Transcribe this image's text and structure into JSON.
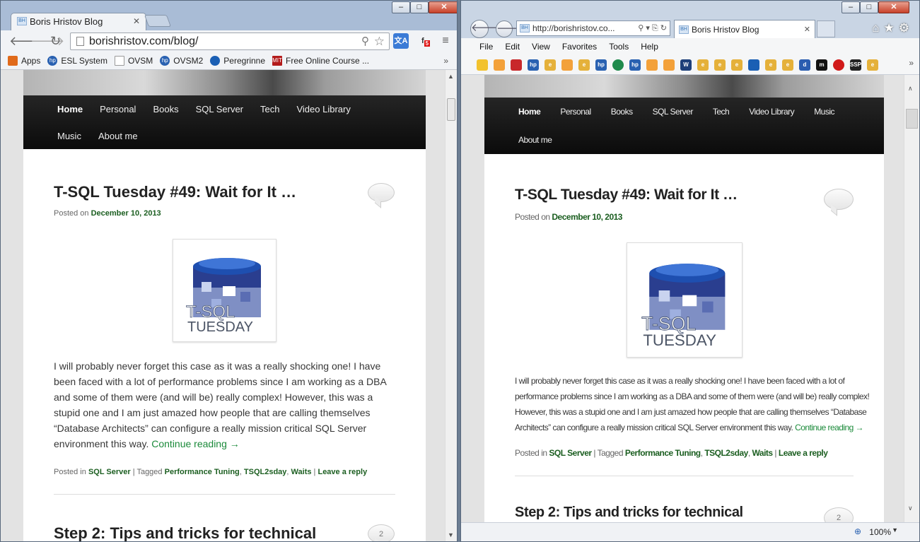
{
  "chrome": {
    "tab_title": "Boris Hristov Blog",
    "favicon_text": "BH",
    "url": "borishristov.com/blog/",
    "bookmarks": [
      {
        "label": "Apps",
        "color": "#e06a1b"
      },
      {
        "label": "ESL System",
        "color": "#2961b1"
      },
      {
        "label": "OVSM",
        "color": "#888888"
      },
      {
        "label": "OVSM2",
        "color": "#2961b1"
      },
      {
        "label": "Peregrinne",
        "color": "#1a5fb4"
      },
      {
        "label": "Free Online Course ...",
        "color": "#b31b1b"
      }
    ],
    "bookmark_overflow": "»",
    "extension_badge": "5"
  },
  "ie": {
    "url": "http://borishristov.co...",
    "tab_title": "Boris Hristov Blog",
    "favicon_text": "BH",
    "menu": [
      "File",
      "Edit",
      "View",
      "Favorites",
      "Tools",
      "Help"
    ],
    "fav_overflow": "»",
    "zoom": "100%",
    "fav_icons": [
      {
        "name": "star-icon",
        "color": "#f2c22e",
        "text": ""
      },
      {
        "name": "feed-icon",
        "color": "#f3a13a",
        "text": ""
      },
      {
        "name": "diamond-icon",
        "color": "#c8282b",
        "text": ""
      },
      {
        "name": "hp-icon",
        "color": "#2961b1",
        "text": "hp"
      },
      {
        "name": "ie-page-icon",
        "color": "#e5b13a",
        "text": "e"
      },
      {
        "name": "feed-icon",
        "color": "#f3a13a",
        "text": ""
      },
      {
        "name": "ie-page-icon",
        "color": "#e5b13a",
        "text": "e"
      },
      {
        "name": "hp-icon",
        "color": "#2961b1",
        "text": "hp"
      },
      {
        "name": "globe-icon",
        "color": "#1f8a4c",
        "text": ""
      },
      {
        "name": "hp-icon",
        "color": "#2961b1",
        "text": "hp"
      },
      {
        "name": "feed-icon",
        "color": "#f3a13a",
        "text": ""
      },
      {
        "name": "feed-icon",
        "color": "#f3a13a",
        "text": ""
      },
      {
        "name": "w-icon",
        "color": "#1d3f7a",
        "text": "W"
      },
      {
        "name": "ie-page-icon",
        "color": "#e5b13a",
        "text": "e"
      },
      {
        "name": "ie-page-icon",
        "color": "#e5b13a",
        "text": "e"
      },
      {
        "name": "ie-page-icon",
        "color": "#e5b13a",
        "text": "e"
      },
      {
        "name": "peregrine-icon",
        "color": "#1a5fb4",
        "text": ""
      },
      {
        "name": "ie-page-icon",
        "color": "#e5b13a",
        "text": "e"
      },
      {
        "name": "ie-page-icon",
        "color": "#e5b13a",
        "text": "e"
      },
      {
        "name": "d-icon",
        "color": "#2a5db0",
        "text": "d"
      },
      {
        "name": "m-icon",
        "color": "#111111",
        "text": "m"
      },
      {
        "name": "red-dot-icon",
        "color": "#d11a1a",
        "text": ""
      },
      {
        "name": "ssp-icon",
        "color": "#222222",
        "text": "SSP"
      },
      {
        "name": "ie-page-icon",
        "color": "#e5b13a",
        "text": "e"
      }
    ]
  },
  "blog": {
    "nav_chrome_row1": [
      "Home",
      "Personal",
      "Books",
      "SQL Server",
      "Tech",
      "Video Library"
    ],
    "nav_chrome_row2": [
      "Music",
      "About me"
    ],
    "nav_ie_row1": [
      "Home",
      "Personal",
      "Books",
      "SQL Server",
      "Tech",
      "Video Library",
      "Music"
    ],
    "nav_ie_row2": [
      "About me"
    ],
    "post1": {
      "title": "T-SQL Tuesday #49: Wait for It …",
      "posted_on": "Posted on",
      "date": "December 10, 2013",
      "logo_line1": "T-SQL",
      "logo_line2": "TUESDAY",
      "excerpt_chrome": [
        "I will probably never forget this case as it was a really shocking one! I have",
        "been faced with a lot of performance problems since I am working as a DBA",
        "and some of them were (and will be) really complex! However, this was a",
        "stupid one and I am just amazed how people that are calling themselves",
        "“Database Architects” can configure a really mission critical SQL Server",
        "environment this way."
      ],
      "excerpt_ie": [
        "I will probably never forget this case as it was a really shocking one! I have been faced with a lot of",
        "performance problems since I am working as a DBA and some of them were (and will be) really complex!",
        "However, this was a stupid one and I am just amazed how people that are calling themselves “Database",
        "Architects” can configure a really mission critical SQL Server environment this way."
      ],
      "continue": "Continue reading →",
      "posted_in": "Posted in",
      "category": "SQL Server",
      "tagged": "| Tagged",
      "tags": [
        "Performance Tuning",
        "TSQL2sday",
        "Waits"
      ],
      "leave_reply": "Leave a reply"
    },
    "post2": {
      "title": "Step 2: Tips and tricks for technical",
      "comments": "2"
    }
  }
}
